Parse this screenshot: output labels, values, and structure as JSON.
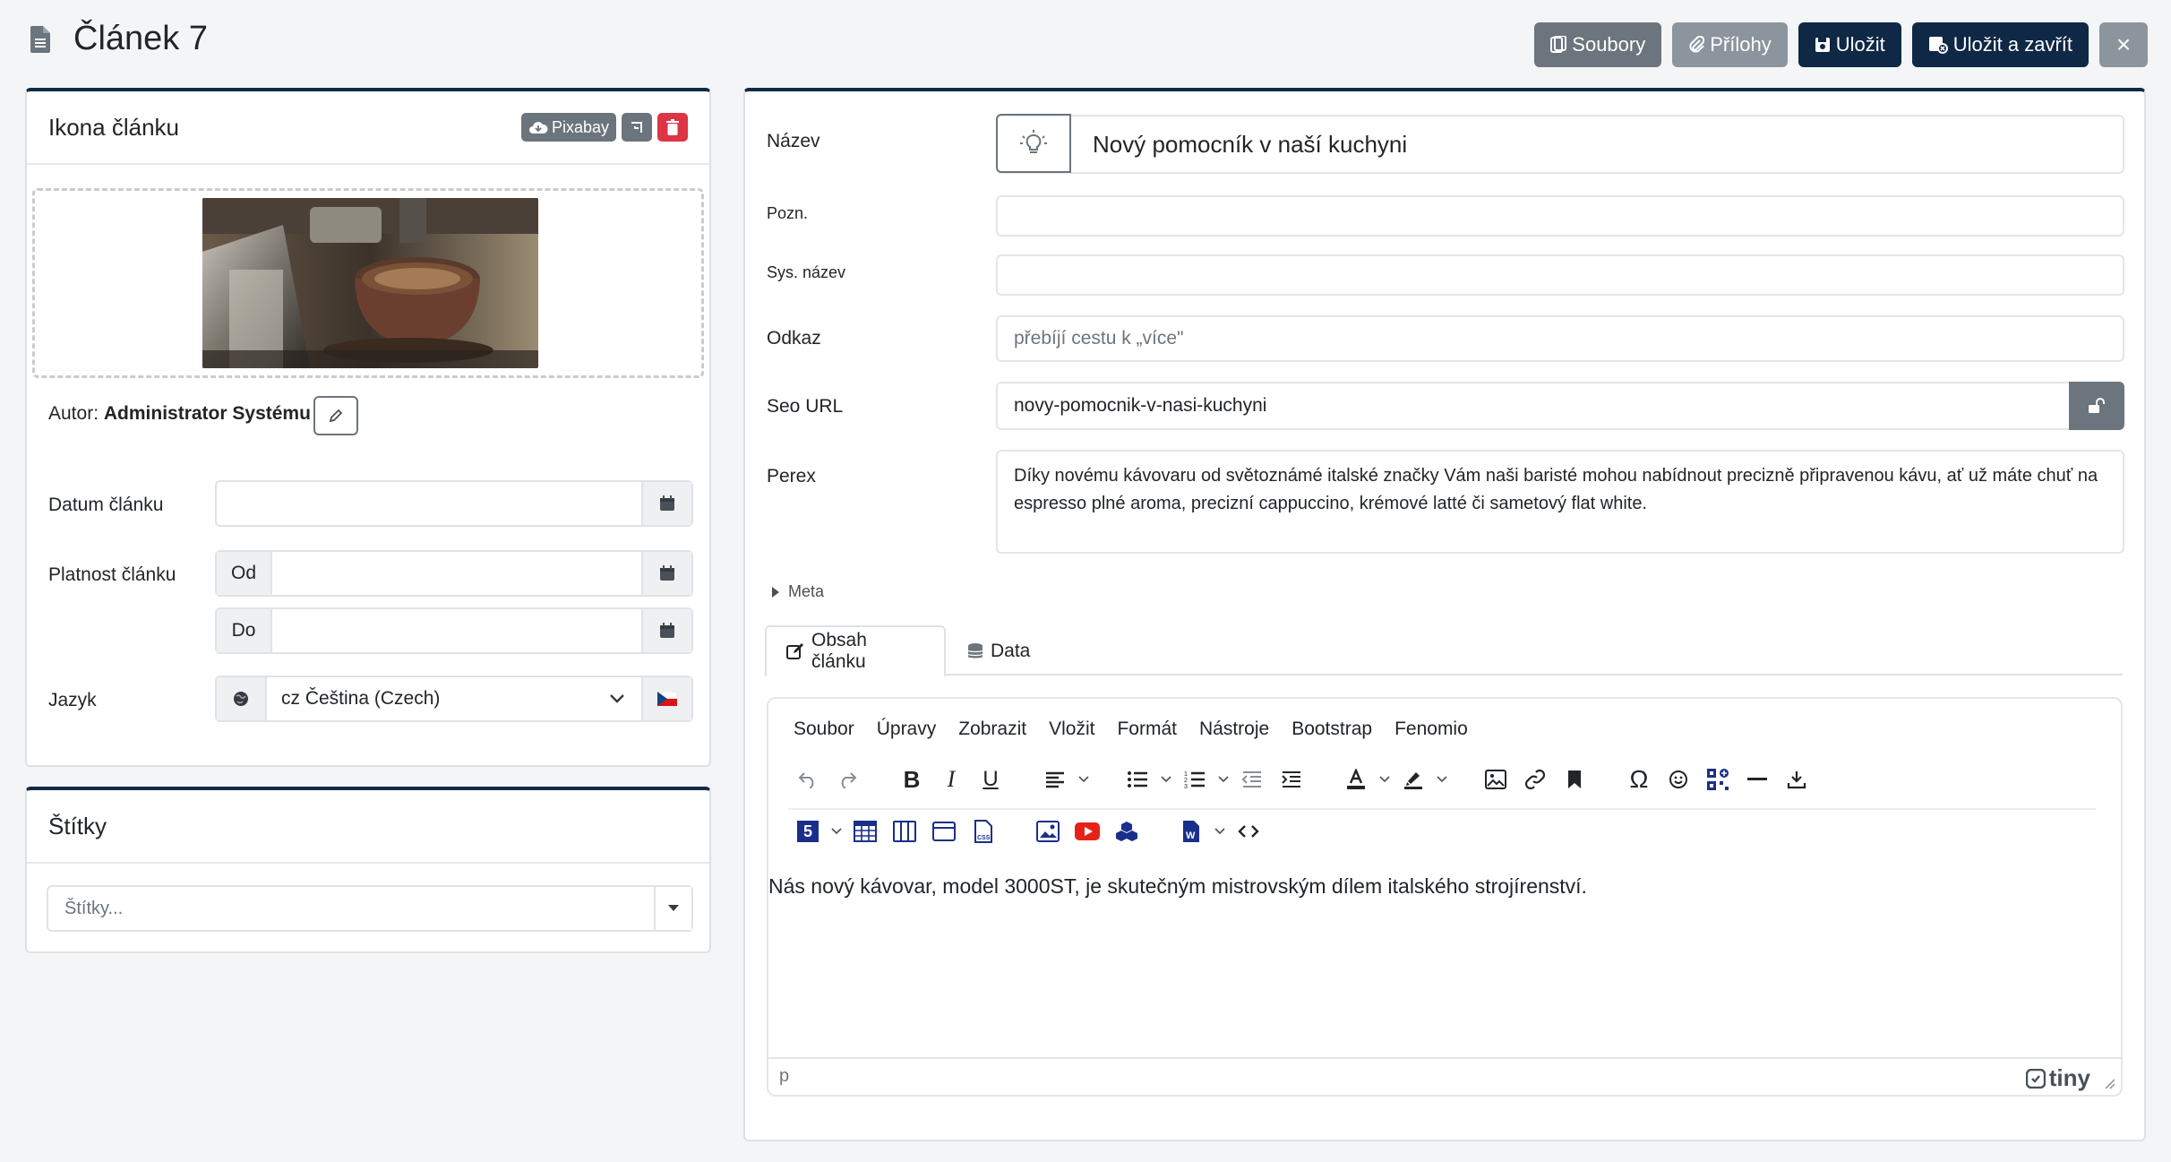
{
  "header": {
    "title": "Článek 7",
    "buttons": {
      "files": "Soubory",
      "attachments": "Přílohy",
      "save": "Uložit",
      "save_close": "Uložit a zavřít",
      "close": "×"
    }
  },
  "icon_card": {
    "title": "Ikona článku",
    "pixabay": "Pixabay",
    "author_label": "Autor:",
    "author_name": "Administrator Systému",
    "date_label": "Datum článku",
    "date_value": "",
    "validity_label": "Platnost článku",
    "from_label": "Od",
    "to_label": "Do",
    "language_label": "Jazyk",
    "language_value": "cz Čeština (Czech)"
  },
  "tags_card": {
    "title": "Štítky",
    "placeholder": "Štítky..."
  },
  "form": {
    "name_label": "Název",
    "name_value": "Nový pomocník v naší kuchyni",
    "note_label": "Pozn.",
    "note_value": "",
    "sysname_label": "Sys. název",
    "sysname_value": "",
    "link_label": "Odkaz",
    "link_placeholder": "přebíjí cestu k „více\"",
    "seo_label": "Seo URL",
    "seo_value": "novy-pomocnik-v-nasi-kuchyni",
    "perex_label": "Perex",
    "perex_value": "Díky novému kávovaru od světoznámé italské značky Vám naši baristé mohou nabídnout precizně připravenou kávu, ať už máte chuť na espresso plné aroma, precizní cappuccino, krémové latté či sametový flat white.",
    "meta_label": "Meta"
  },
  "tabs": [
    {
      "label": "Obsah článku"
    },
    {
      "label": "Data"
    }
  ],
  "editor": {
    "menu": [
      "Soubor",
      "Úpravy",
      "Zobrazit",
      "Vložit",
      "Formát",
      "Nástroje",
      "Bootstrap",
      "Fenomio"
    ],
    "content": "Nás nový kávovar, model 3000ST, je skutečným mistrovským dílem italského strojírenství.",
    "status_path": "p",
    "brand": "tiny",
    "h5_label": "5"
  },
  "colors": {
    "primary_dark": "#0f2846",
    "secondary": "#6c757d",
    "danger": "#dc3545",
    "youtube": "#e62117"
  }
}
